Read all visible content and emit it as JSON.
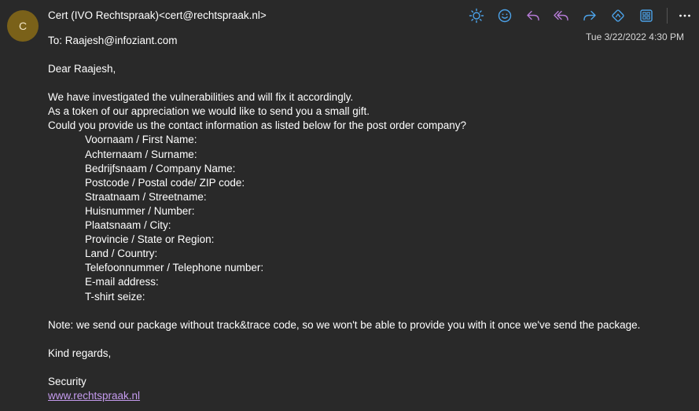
{
  "message": {
    "avatar_initial": "C",
    "sender": "Cert (IVO Rechtspraak)<cert@rechtspraak.nl>",
    "recipient": "To:  Raajesh@infoziant.com",
    "timestamp": "Tue 3/22/2022 4:30 PM"
  },
  "toolbar": {
    "icons": [
      "sun-icon",
      "smiley-icon",
      "reply-icon",
      "reply-all-icon",
      "forward-icon",
      "immersive-reader-icon",
      "apps-grid-icon",
      "more-icon"
    ],
    "accent_color": "#4ca3ea",
    "purple_color": "#b57bd6"
  },
  "body": {
    "greeting": "Dear Raajesh,",
    "paragraph_lines": [
      "We have investigated the vulnerabilities and will fix it accordingly.",
      "As a token of our appreciation we would like to send you a small gift.",
      "Could you provide us the contact information as listed below for the post order company?"
    ],
    "fields": [
      "Voornaam / First Name:",
      "Achternaam / Surname:",
      "Bedrijfsnaam / Company Name:",
      "Postcode / Postal code/ ZIP code:",
      "Straatnaam / Streetname:",
      "Huisnummer / Number:",
      "Plaatsnaam / City:",
      "Provincie / State or Region:",
      "Land / Country:",
      "Telefoonnummer / Telephone number:",
      "E-mail address:",
      "T-shirt seize:"
    ],
    "note": "Note: we send our package without track&trace code, so we won't be able to provide you with it once we've send the package.",
    "closing": "Kind regards,",
    "signature_name": "Security",
    "signature_link": "www.rechtspraak.nl"
  }
}
